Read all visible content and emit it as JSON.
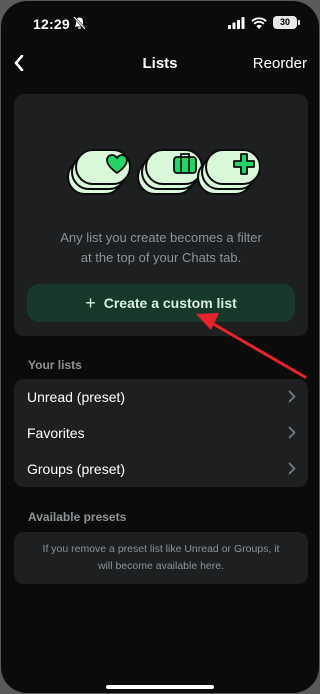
{
  "status": {
    "time": "12:29",
    "battery": "30"
  },
  "nav": {
    "title": "Lists",
    "reorder": "Reorder"
  },
  "intro": {
    "text_line1": "Any list you create becomes a filter",
    "text_line2": "at the top of your Chats tab.",
    "button_plus": "+",
    "button_label": "Create a custom list",
    "icons": [
      "heart-icon",
      "briefcase-icon",
      "plus-icon"
    ]
  },
  "your_lists": {
    "header": "Your lists",
    "items": [
      {
        "label": "Unread (preset)"
      },
      {
        "label": "Favorites"
      },
      {
        "label": "Groups (preset)"
      }
    ]
  },
  "presets": {
    "header": "Available presets",
    "text_line1": "If you remove a preset list like Unread or Groups, it",
    "text_line2": "will become available here."
  },
  "colors": {
    "background": "#0b0b0c",
    "card": "#1d1f20",
    "button": "#17382a",
    "accent_green": "#25d366",
    "pale_green": "#d9f7d9",
    "arrow_red": "#e8232a"
  }
}
